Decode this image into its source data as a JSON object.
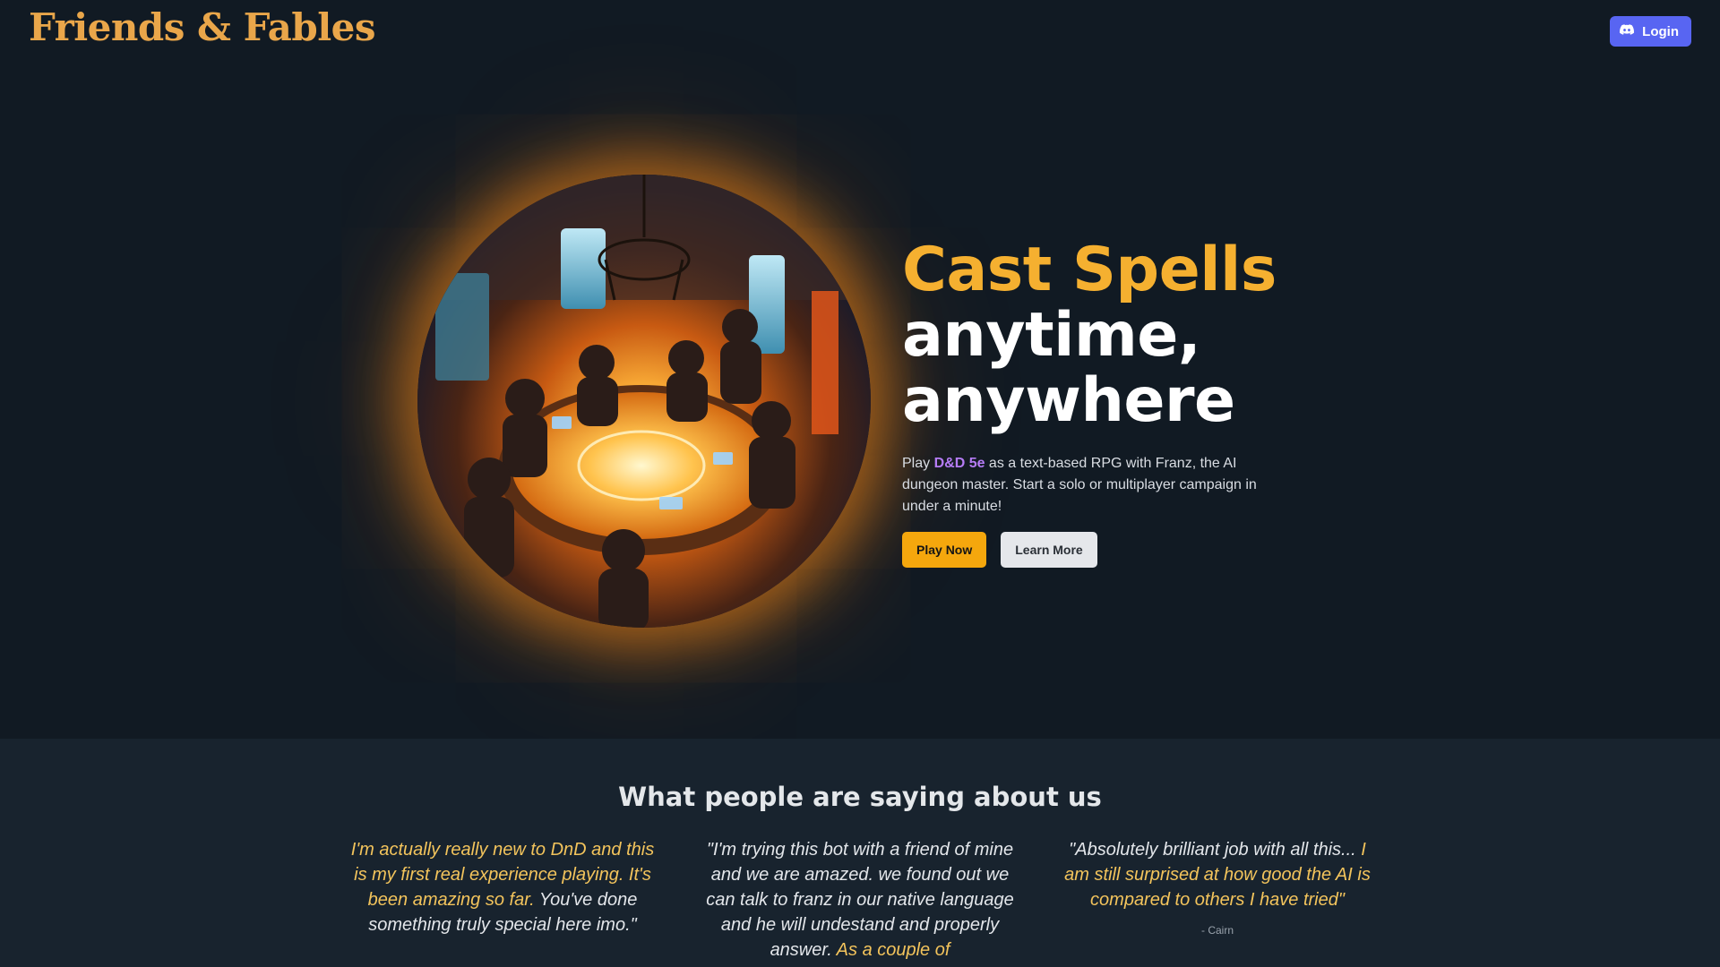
{
  "header": {
    "logo": "Friends & Fables",
    "login_label": "Login",
    "login_icon": "discord-icon"
  },
  "hero": {
    "image_alt": "Adventurers gathered around a glowing round table",
    "headline_accent": "Cast Spells",
    "headline_line2": "anytime,",
    "headline_line3": "anywhere",
    "sub_prefix": "Play ",
    "sub_highlight": "D&D 5e",
    "sub_suffix": " as a text-based RPG with Franz, the AI dungeon master. Start a solo or multiplayer campaign in under a minute!",
    "play_label": "Play Now",
    "learn_label": "Learn More"
  },
  "testimonials": {
    "title": "What people are saying about us",
    "quotes": [
      {
        "highlight": "I'm actually really new to DnD and this is my first real experience playing. It's been amazing so far.",
        "rest": " You've done something truly special here imo.\""
      },
      {
        "lead": "\"I'm trying this bot with a friend of mine and we are amazed. we found out we can talk to franz in our native language and he will undestand and properly answer. ",
        "highlight": "As a couple of"
      },
      {
        "lead": "\"Absolutely brilliant job with all this...",
        "highlight": " I am still surprised at how good the AI is compared to others I have tried\"",
        "author": "- Cairn"
      }
    ]
  },
  "colors": {
    "background": "#111a23",
    "accent": "#f5b030",
    "logo": "#e9a64a",
    "discord": "#5865f2",
    "dnd": "#b57cf5"
  }
}
